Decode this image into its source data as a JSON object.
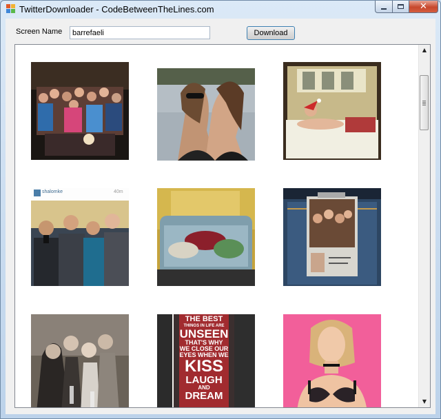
{
  "window": {
    "title": "TwitterDownloader - CodeBetweenTheLines.com"
  },
  "controls": {
    "minimize": "minimize",
    "maximize": "maximize",
    "close": "close"
  },
  "form": {
    "screen_name_label": "Screen Name",
    "screen_name_value": "barrefaeli",
    "download_label": "Download"
  },
  "gallery": {
    "photos": [
      {
        "name": "group-party-photo",
        "caption": ""
      },
      {
        "name": "beach-selfie-photo",
        "caption": ""
      },
      {
        "name": "santa-hat-bed-photo",
        "caption": ""
      },
      {
        "name": "instagram-group-selfie-photo",
        "caption": "shalomke",
        "time": "40m"
      },
      {
        "name": "couch-blankets-photo",
        "caption": ""
      },
      {
        "name": "jeans-pocket-badge-photo",
        "caption": ""
      },
      {
        "name": "friends-dinner-photo",
        "caption": ""
      },
      {
        "name": "quote-poster-photo",
        "quote": [
          "THE BEST",
          "THINGS IN LIFE ARE",
          "UNSEEN",
          "THAT'S WHY",
          "WE CLOSE OUR",
          "EYES WHEN WE",
          "KISS",
          "LAUGH",
          "AND",
          "DREAM"
        ]
      },
      {
        "name": "lingerie-portrait-photo",
        "caption": ""
      }
    ]
  },
  "icons": {
    "scroll_up": "arrow-up-icon",
    "scroll_down": "arrow-down-icon",
    "app": "app-icon"
  }
}
